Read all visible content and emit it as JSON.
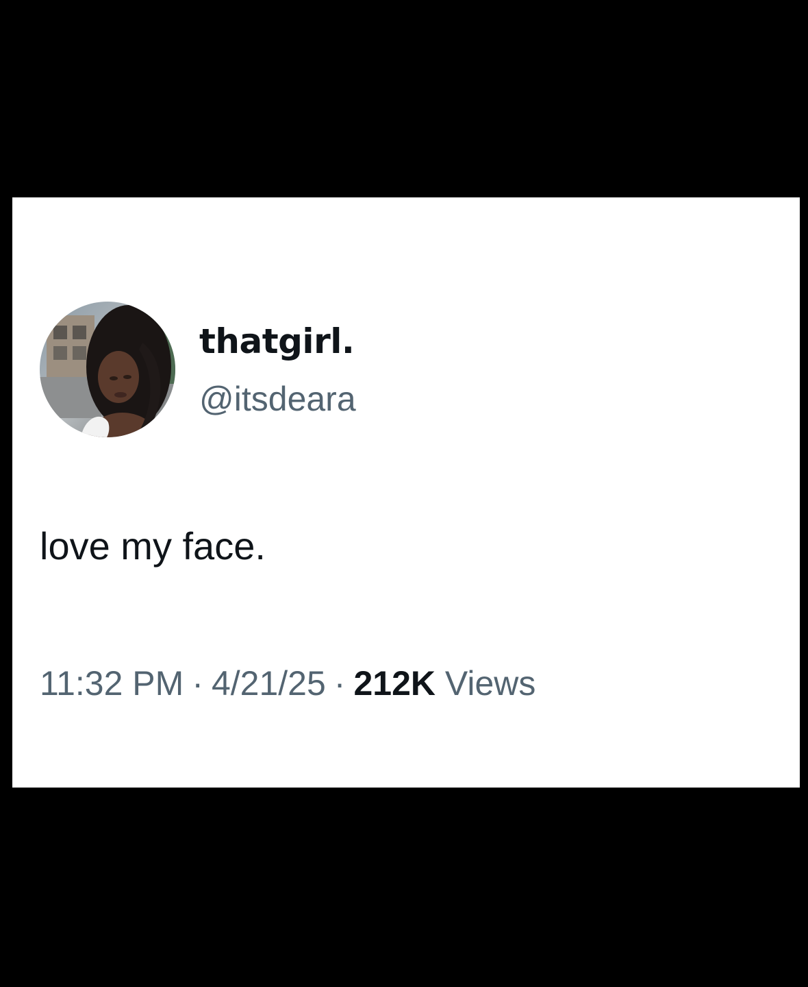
{
  "tweet": {
    "display_name": "thatgirl.",
    "handle": "@itsdeara",
    "text": "love my face.",
    "time": "11:32 PM",
    "separator": "·",
    "date": "4/21/25",
    "views_count": "212K",
    "views_label": "Views"
  },
  "colors": {
    "page_background": "#000000",
    "card_background": "#ffffff",
    "primary_text": "#0f1419",
    "secondary_text": "#536471"
  }
}
